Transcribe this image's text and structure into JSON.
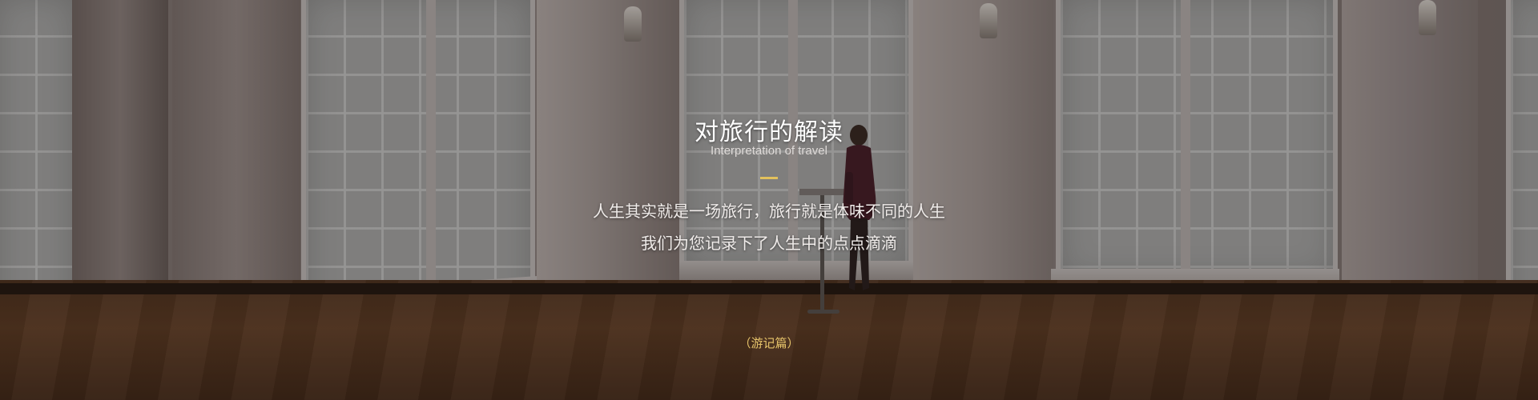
{
  "banner": {
    "title": "对旅行的解读",
    "subtitle": "Interpretation of travel",
    "description_lines": [
      "人生其实就是一场旅行，旅行就是体味不同的人生",
      "我们为您记录下了人生中的点点滴滴"
    ],
    "more_link": "（游记篇）"
  },
  "colors": {
    "accent": "#e2c15c",
    "link": "#e6c36a",
    "text": "#ffffff"
  }
}
